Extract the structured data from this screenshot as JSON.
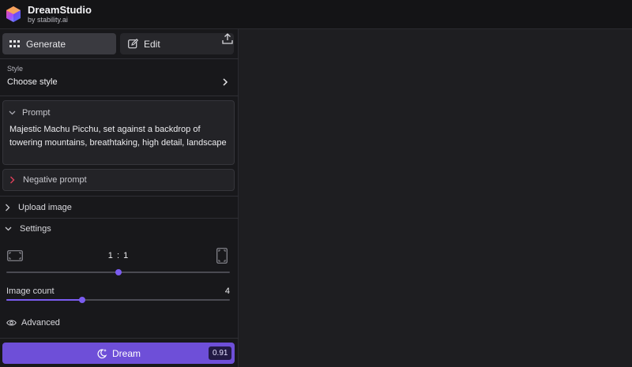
{
  "brand": {
    "name": "DreamStudio",
    "sub": "by stability.ai"
  },
  "modes": {
    "generate_label": "Generate",
    "edit_label": "Edit",
    "active": "Generate"
  },
  "style": {
    "label": "Style",
    "value": "Choose style"
  },
  "prompt": {
    "label": "Prompt",
    "text": "Majestic Machu Picchu, set against a backdrop of towering mountains, breathtaking, high detail, landscape"
  },
  "negative_prompt": {
    "label": "Negative prompt"
  },
  "upload": {
    "label": "Upload image"
  },
  "settings": {
    "label": "Settings",
    "aspect_ratio": {
      "value": "1 : 1",
      "slider_fraction": 0.5
    },
    "image_count": {
      "label": "Image count",
      "value": "4",
      "slider_fraction": 0.34
    },
    "advanced_label": "Advanced"
  },
  "dream": {
    "label": "Dream",
    "credits": "0.91"
  },
  "colors": {
    "accent": "#6e4fd8",
    "slider_accent": "#7b5cf0",
    "background": "#1e1e21",
    "sidebar": "#18181b"
  },
  "icons": {
    "logo": "dreamstudio-logo",
    "generate": "grid-icon",
    "edit": "edit-icon",
    "upload": "upload-icon",
    "advanced": "eye-icon",
    "dream": "moon-sparkle-icon"
  }
}
